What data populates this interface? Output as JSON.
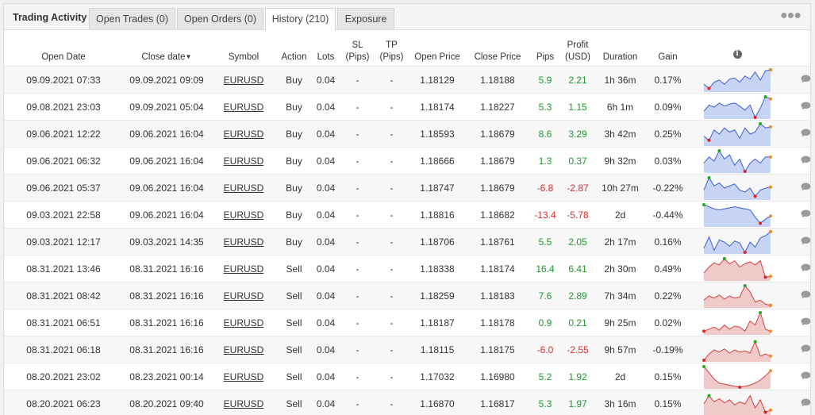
{
  "tabs": {
    "title": "Trading Activity",
    "items": [
      {
        "label": "Open Trades (0)",
        "active": false
      },
      {
        "label": "Open Orders (0)",
        "active": false
      },
      {
        "label": "History (210)",
        "active": true
      },
      {
        "label": "Exposure",
        "active": false
      }
    ],
    "more_icon": "more-horizontal-icon"
  },
  "table": {
    "headers": {
      "open_date": "Open Date",
      "close_date": "Close date",
      "symbol": "Symbol",
      "action": "Action",
      "lots": "Lots",
      "sl_1": "SL",
      "sl_2": "(Pips)",
      "tp_1": "TP",
      "tp_2": "(Pips)",
      "open_price": "Open Price",
      "close_price": "Close Price",
      "pips": "Pips",
      "profit_1": "Profit",
      "profit_2": "(USD)",
      "duration": "Duration",
      "gain": "Gain",
      "info_icon": "i"
    },
    "colors": {
      "positive": "#1e9a2e",
      "negative": "#e02d2d",
      "buy_fill": "#c8d4f5",
      "buy_line": "#3a5fd9",
      "sell_fill": "#f0c9c9",
      "sell_line": "#d34040"
    },
    "rows": [
      {
        "open_date": "09.09.2021 07:33",
        "close_date": "09.09.2021 09:09",
        "symbol": "EURUSD",
        "action": "Buy",
        "lots": "0.04",
        "sl": "-",
        "tp": "-",
        "open_price": "1.18129",
        "close_price": "1.18188",
        "pips": "5.9",
        "profit": "2.21",
        "duration": "1h 36m",
        "gain": "0.17%",
        "spark": [
          0.3,
          0.1,
          0.4,
          0.5,
          0.3,
          0.55,
          0.6,
          0.4,
          0.7,
          0.55,
          0.9,
          0.5,
          0.95,
          1.0
        ]
      },
      {
        "open_date": "09.08.2021 23:03",
        "close_date": "09.09.2021 05:04",
        "symbol": "EURUSD",
        "action": "Buy",
        "lots": "0.04",
        "sl": "-",
        "tp": "-",
        "open_price": "1.18174",
        "close_price": "1.18227",
        "pips": "5.3",
        "profit": "1.15",
        "duration": "6h 1m",
        "gain": "0.09%",
        "spark": [
          0.3,
          0.6,
          0.5,
          0.7,
          0.55,
          0.65,
          0.7,
          0.55,
          0.35,
          0.6,
          0.0,
          0.45,
          1.0,
          0.9
        ]
      },
      {
        "open_date": "09.06.2021 12:22",
        "close_date": "09.06.2021 16:04",
        "symbol": "EURUSD",
        "action": "Buy",
        "lots": "0.04",
        "sl": "-",
        "tp": "-",
        "open_price": "1.18593",
        "close_price": "1.18679",
        "pips": "8.6",
        "profit": "3.29",
        "duration": "3h 42m",
        "gain": "0.25%",
        "spark": [
          0.4,
          0.2,
          0.7,
          0.5,
          0.8,
          0.6,
          0.7,
          0.3,
          0.8,
          0.5,
          0.6,
          1.0,
          0.8,
          0.85
        ]
      },
      {
        "open_date": "09.06.2021 06:32",
        "close_date": "09.06.2021 16:04",
        "symbol": "EURUSD",
        "action": "Buy",
        "lots": "0.04",
        "sl": "-",
        "tp": "-",
        "open_price": "1.18666",
        "close_price": "1.18679",
        "pips": "1.3",
        "profit": "0.37",
        "duration": "9h 32m",
        "gain": "0.03%",
        "spark": [
          0.4,
          0.7,
          0.5,
          1.0,
          0.6,
          0.8,
          0.3,
          0.6,
          0.0,
          0.4,
          0.6,
          0.4,
          0.7,
          0.7
        ]
      },
      {
        "open_date": "09.06.2021 05:37",
        "close_date": "09.06.2021 16:04",
        "symbol": "EURUSD",
        "action": "Buy",
        "lots": "0.04",
        "sl": "-",
        "tp": "-",
        "open_price": "1.18747",
        "close_price": "1.18679",
        "pips": "-6.8",
        "profit": "-2.87",
        "duration": "10h 27m",
        "gain": "-0.22%",
        "spark": [
          0.4,
          1.0,
          0.6,
          0.75,
          0.5,
          0.6,
          0.7,
          0.4,
          0.3,
          0.5,
          0.1,
          0.4,
          0.5,
          0.55
        ]
      },
      {
        "open_date": "09.03.2021 22:58",
        "close_date": "09.06.2021 16:04",
        "symbol": "EURUSD",
        "action": "Buy",
        "lots": "0.04",
        "sl": "-",
        "tp": "-",
        "open_price": "1.18816",
        "close_price": "1.18682",
        "pips": "-13.4",
        "profit": "-5.78",
        "duration": "2d",
        "gain": "-0.44%",
        "spark": [
          1.0,
          0.9,
          0.8,
          0.75,
          0.8,
          0.85,
          0.9,
          0.85,
          0.8,
          0.75,
          0.4,
          0.1,
          0.3,
          0.45
        ]
      },
      {
        "open_date": "09.03.2021 12:17",
        "close_date": "09.03.2021 14:35",
        "symbol": "EURUSD",
        "action": "Buy",
        "lots": "0.04",
        "sl": "-",
        "tp": "-",
        "open_price": "1.18706",
        "close_price": "1.18761",
        "pips": "5.5",
        "profit": "2.05",
        "duration": "2h 17m",
        "gain": "0.16%",
        "spark": [
          0.2,
          0.75,
          0.1,
          0.6,
          0.5,
          0.3,
          0.55,
          0.45,
          0.0,
          0.5,
          0.25,
          0.7,
          0.8,
          1.0
        ]
      },
      {
        "open_date": "08.31.2021 13:46",
        "close_date": "08.31.2021 16:16",
        "symbol": "EURUSD",
        "action": "Sell",
        "lots": "0.04",
        "sl": "-",
        "tp": "-",
        "open_price": "1.18338",
        "close_price": "1.18174",
        "pips": "16.4",
        "profit": "6.41",
        "duration": "2h 30m",
        "gain": "0.49%",
        "spark": [
          0.3,
          0.6,
          0.8,
          0.7,
          1.0,
          0.75,
          0.9,
          0.6,
          0.75,
          0.85,
          0.7,
          0.9,
          0.1,
          0.15
        ]
      },
      {
        "open_date": "08.31.2021 08:42",
        "close_date": "08.31.2021 16:16",
        "symbol": "EURUSD",
        "action": "Sell",
        "lots": "0.04",
        "sl": "-",
        "tp": "-",
        "open_price": "1.18259",
        "close_price": "1.18183",
        "pips": "7.6",
        "profit": "2.89",
        "duration": "7h 34m",
        "gain": "0.22%",
        "spark": [
          0.3,
          0.5,
          0.4,
          0.55,
          0.35,
          0.5,
          0.4,
          0.45,
          1.0,
          0.7,
          0.2,
          0.3,
          0.1,
          0.05
        ]
      },
      {
        "open_date": "08.31.2021 06:51",
        "close_date": "08.31.2021 16:16",
        "symbol": "EURUSD",
        "action": "Sell",
        "lots": "0.04",
        "sl": "-",
        "tp": "-",
        "open_price": "1.18187",
        "close_price": "1.18178",
        "pips": "0.9",
        "profit": "0.21",
        "duration": "9h 25m",
        "gain": "0.02%",
        "spark": [
          0.1,
          0.2,
          0.3,
          0.15,
          0.4,
          0.2,
          0.35,
          0.3,
          0.1,
          0.6,
          0.4,
          1.0,
          0.2,
          0.1
        ]
      },
      {
        "open_date": "08.31.2021 06:18",
        "close_date": "08.31.2021 16:16",
        "symbol": "EURUSD",
        "action": "Sell",
        "lots": "0.04",
        "sl": "-",
        "tp": "-",
        "open_price": "1.18115",
        "close_price": "1.18175",
        "pips": "-6.0",
        "profit": "-2.55",
        "duration": "9h 57m",
        "gain": "-0.19%",
        "spark": [
          0.0,
          0.3,
          0.5,
          0.4,
          0.55,
          0.35,
          0.5,
          0.4,
          0.45,
          0.35,
          0.9,
          0.2,
          0.3,
          0.2
        ]
      },
      {
        "open_date": "08.20.2021 23:02",
        "close_date": "08.23.2021 00:14",
        "symbol": "EURUSD",
        "action": "Sell",
        "lots": "0.04",
        "sl": "-",
        "tp": "-",
        "open_price": "1.17032",
        "close_price": "1.16980",
        "pips": "5.2",
        "profit": "1.92",
        "duration": "2d",
        "gain": "0.15%",
        "spark": [
          1.0,
          0.7,
          0.4,
          0.2,
          0.15,
          0.1,
          0.05,
          0.0,
          0.05,
          0.1,
          0.2,
          0.35,
          0.55,
          0.8
        ]
      },
      {
        "open_date": "08.20.2021 06:23",
        "close_date": "08.20.2021 09:40",
        "symbol": "EURUSD",
        "action": "Sell",
        "lots": "0.04",
        "sl": "-",
        "tp": "-",
        "open_price": "1.16870",
        "close_price": "1.16817",
        "pips": "5.3",
        "profit": "1.97",
        "duration": "3h 16m",
        "gain": "0.15%",
        "spark": [
          0.5,
          0.9,
          0.6,
          0.75,
          0.55,
          0.7,
          0.45,
          0.6,
          0.5,
          0.9,
          0.3,
          0.7,
          0.1,
          0.2
        ]
      }
    ],
    "next_row_spark": "partial"
  }
}
